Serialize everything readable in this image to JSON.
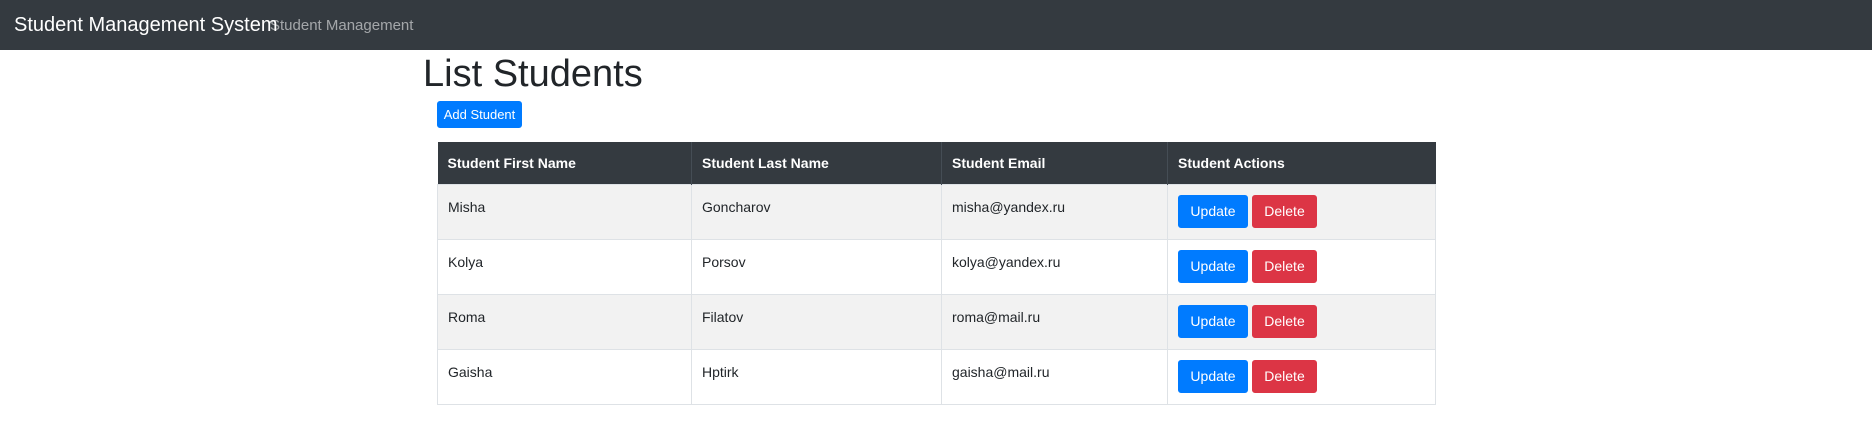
{
  "navbar": {
    "brand": "Student Management System",
    "link": "Student Management"
  },
  "page": {
    "title": "List Students",
    "add_button": "Add Student"
  },
  "table": {
    "headers": [
      "Student First Name",
      "Student Last Name",
      "Student Email",
      "Student Actions"
    ],
    "update_label": "Update",
    "delete_label": "Delete",
    "rows": [
      {
        "first": "Misha",
        "last": "Goncharov",
        "email": "misha@yandex.ru"
      },
      {
        "first": "Kolya",
        "last": "Porsov",
        "email": "kolya@yandex.ru"
      },
      {
        "first": "Roma",
        "last": "Filatov",
        "email": "roma@mail.ru"
      },
      {
        "first": "Gaisha",
        "last": "Hptirk",
        "email": "gaisha@mail.ru"
      }
    ]
  },
  "colors": {
    "navbar_bg": "#343a40",
    "primary": "#007bff",
    "danger": "#dc3545",
    "stripe": "#f2f2f2"
  }
}
